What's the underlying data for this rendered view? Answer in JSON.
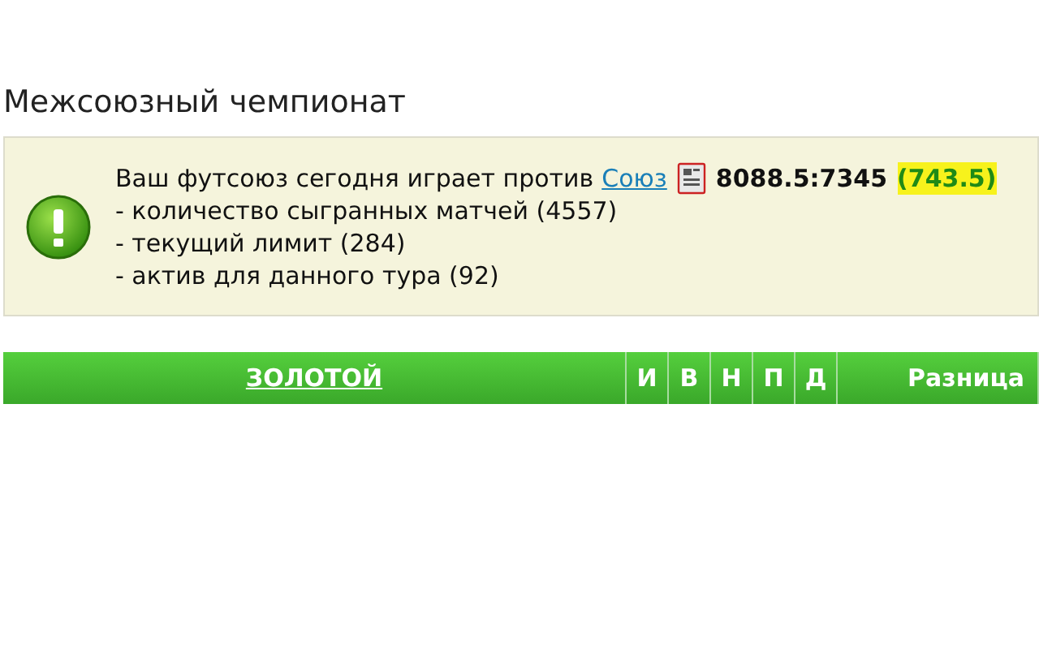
{
  "title": "Межсоюзный чемпионат",
  "notice": {
    "text": "Ваш футсоюз сегодня играет против",
    "link": "Союз",
    "score": "8088.5:7345",
    "difference": "(743.5)",
    "items": [
      "- количество сыгранных матчей (4557)",
      "- текущий лимит (284)",
      "- актив для данного тура (92)"
    ]
  },
  "table": {
    "columns": [
      {
        "label": "ЗОЛОТОЙ",
        "kind": "link"
      },
      {
        "label": "И",
        "kind": "text"
      },
      {
        "label": "В",
        "kind": "text"
      },
      {
        "label": "Н",
        "kind": "text"
      },
      {
        "label": "П",
        "kind": "text"
      },
      {
        "label": "Д",
        "kind": "text"
      },
      {
        "label": "Разница",
        "kind": "wide"
      }
    ]
  }
}
